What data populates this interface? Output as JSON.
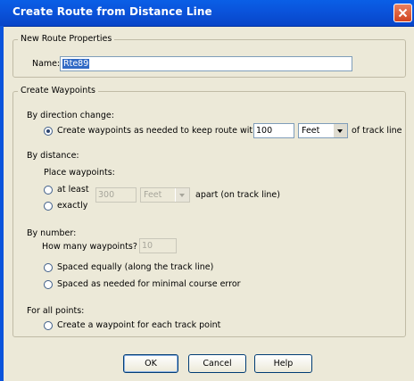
{
  "window": {
    "title": "Create Route from Distance Line"
  },
  "new_route": {
    "legend": "New Route Properties",
    "name_label": "Name:",
    "name_value": "Rte89"
  },
  "waypoints": {
    "legend": "Create Waypoints",
    "direction": {
      "heading": "By direction change:",
      "option_label": "Create waypoints as needed to keep route within",
      "value": "100",
      "unit": "Feet",
      "suffix": "of track line",
      "selected": true
    },
    "distance": {
      "heading": "By distance:",
      "place_label": "Place waypoints:",
      "at_least_label": "at least",
      "exactly_label": "exactly",
      "value": "300",
      "unit": "Feet",
      "suffix": "apart (on track line)"
    },
    "number": {
      "heading": "By number:",
      "how_many_label": "How many waypoints?",
      "value": "10",
      "spaced_equally_label": "Spaced equally (along the track line)",
      "spaced_needed_label": "Spaced as needed for minimal course error"
    },
    "all_points": {
      "heading": "For all points:",
      "option_label": "Create a waypoint for each track point"
    }
  },
  "buttons": {
    "ok": "OK",
    "cancel": "Cancel",
    "help": "Help"
  }
}
